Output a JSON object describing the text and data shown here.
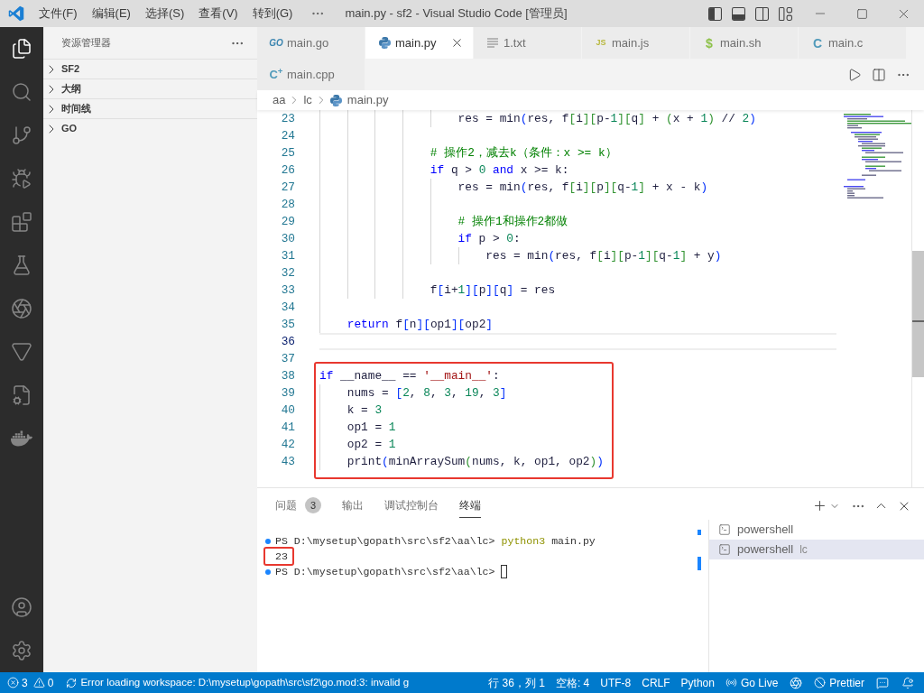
{
  "title_bar": {
    "menus": [
      "文件(F)",
      "编辑(E)",
      "选择(S)",
      "查看(V)",
      "转到(G)"
    ],
    "title": "main.py - sf2 - Visual Studio Code [管理员]",
    "layout_toggles": [
      {
        "kind": "sidebar",
        "on": true
      },
      {
        "kind": "panel",
        "on": true
      },
      {
        "kind": "secondary",
        "on": false
      }
    ]
  },
  "activity_bar": {
    "items": [
      {
        "kind": "explorer",
        "selected": true
      },
      {
        "kind": "search",
        "selected": false
      },
      {
        "kind": "scm",
        "selected": false
      },
      {
        "kind": "debug",
        "selected": false
      },
      {
        "kind": "extensions",
        "selected": false
      },
      {
        "kind": "testing",
        "selected": false
      },
      {
        "kind": "ai",
        "selected": false
      },
      {
        "kind": "triangle",
        "selected": false
      },
      {
        "kind": "remote",
        "selected": false
      },
      {
        "kind": "docker",
        "selected": false
      }
    ]
  },
  "sidebar": {
    "title": "资源管理器",
    "sections": [
      {
        "label": "SF2",
        "expanded": false
      },
      {
        "label": "大纲",
        "expanded": false
      },
      {
        "label": "时间线",
        "expanded": false
      },
      {
        "label": "GO",
        "expanded": false
      }
    ]
  },
  "tabs": [
    {
      "label": "main.go",
      "kind": "go",
      "icon_text": "GO",
      "selected": false
    },
    {
      "label": "main.py",
      "kind": "python",
      "selected": true
    },
    {
      "label": "1.txt",
      "kind": "text",
      "selected": false
    },
    {
      "label": "main.js",
      "kind": "js",
      "icon_text": "JS",
      "selected": false
    },
    {
      "label": "main.sh",
      "kind": "shell",
      "icon_text": "$",
      "selected": false
    },
    {
      "label": "main.c",
      "kind": "c",
      "icon_text": "C",
      "selected": false
    },
    {
      "label": "main.cpp",
      "kind": "cpp",
      "icon_text": "C$^{+}$",
      "selected": false
    }
  ],
  "breadcrumb": [
    {
      "label": "aa",
      "kind": "folder"
    },
    {
      "label": "lc",
      "kind": "folder"
    },
    {
      "label": "main.py",
      "kind": "python"
    }
  ],
  "editor": {
    "blocks": [
      {
        "highlighted": false,
        "lines": [
          {
            "children": [
              {
                "children": [
                  {
                    "children": [
                      {
                        "children": [
                          {
                            "children": [
                              {
                                "number": "23",
                                "current": false,
                                "code": [
                                  {
                                    "kind": "plain",
                                    "text": "res = min"
                                  },
                                  {
                                    "kind": "b1",
                                    "text": "("
                                  },
                                  {
                                    "kind": "plain",
                                    "text": "res, f"
                                  },
                                  {
                                    "kind": "b2",
                                    "text": "["
                                  },
                                  {
                                    "kind": "plain",
                                    "text": "i"
                                  },
                                  {
                                    "kind": "b2",
                                    "text": "]["
                                  },
                                  {
                                    "kind": "plain",
                                    "text": "p-"
                                  },
                                  {
                                    "kind": "num",
                                    "text": "1"
                                  },
                                  {
                                    "kind": "b2",
                                    "text": "]["
                                  },
                                  {
                                    "kind": "plain",
                                    "text": "q"
                                  },
                                  {
                                    "kind": "b2",
                                    "text": "]"
                                  },
                                  {
                                    "kind": "plain",
                                    "text": " + "
                                  },
                                  {
                                    "kind": "b2",
                                    "text": "("
                                  },
                                  {
                                    "kind": "plain",
                                    "text": "x + "
                                  },
                                  {
                                    "kind": "num",
                                    "text": "1"
                                  },
                                  {
                                    "kind": "b2",
                                    "text": ")"
                                  },
                                  {
                                    "kind": "plain",
                                    "text": " // "
                                  },
                                  {
                                    "kind": "num",
                                    "text": "2"
                                  },
                                  {
                                    "kind": "b1",
                                    "text": ")"
                                  }
                                ]
                              }
                            ]
                          },
                          {
                            "number": "24",
                            "current": false
                          },
                          {
                            "number": "25",
                            "current": false,
                            "code": [
                              {
                                "kind": "comment",
                                "text": "# 操作2，减去k（条件：x >= k）"
                              }
                            ]
                          },
                          {
                            "number": "26",
                            "current": false,
                            "code": [
                              {
                                "kind": "kw",
                                "text": "if"
                              },
                              {
                                "kind": "plain",
                                "text": " q > "
                              },
                              {
                                "kind": "num",
                                "text": "0"
                              },
                              {
                                "kind": "kw",
                                "text": " and"
                              },
                              {
                                "kind": "plain",
                                "text": " x >= k:"
                              }
                            ],
                            "children": [
                              {
                                "number": "27",
                                "current": false,
                                "code": [
                                  {
                                    "kind": "plain",
                                    "text": "res = min"
                                  },
                                  {
                                    "kind": "b1",
                                    "text": "("
                                  },
                                  {
                                    "kind": "plain",
                                    "text": "res, f"
                                  },
                                  {
                                    "kind": "b2",
                                    "text": "["
                                  },
                                  {
                                    "kind": "plain",
                                    "text": "i"
                                  },
                                  {
                                    "kind": "b2",
                                    "text": "]["
                                  },
                                  {
                                    "kind": "plain",
                                    "text": "p"
                                  },
                                  {
                                    "kind": "b2",
                                    "text": "]["
                                  },
                                  {
                                    "kind": "plain",
                                    "text": "q-"
                                  },
                                  {
                                    "kind": "num",
                                    "text": "1"
                                  },
                                  {
                                    "kind": "b2",
                                    "text": "]"
                                  },
                                  {
                                    "kind": "plain",
                                    "text": " + x - k"
                                  },
                                  {
                                    "kind": "b1",
                                    "text": ")"
                                  }
                                ]
                              },
                              {
                                "number": "28",
                                "current": false
                              },
                              {
                                "number": "29",
                                "current": false,
                                "code": [
                                  {
                                    "kind": "comment",
                                    "text": "# 操作1和操作2都做"
                                  }
                                ]
                              },
                              {
                                "number": "30",
                                "current": false,
                                "code": [
                                  {
                                    "kind": "kw",
                                    "text": "if"
                                  },
                                  {
                                    "kind": "plain",
                                    "text": " p > "
                                  },
                                  {
                                    "kind": "num",
                                    "text": "0"
                                  },
                                  {
                                    "kind": "plain",
                                    "text": ":"
                                  }
                                ],
                                "children": [
                                  {
                                    "number": "31",
                                    "current": false,
                                    "code": [
                                      {
                                        "kind": "plain",
                                        "text": "res = min"
                                      },
                                      {
                                        "kind": "b1",
                                        "text": "("
                                      },
                                      {
                                        "kind": "plain",
                                        "text": "res, f"
                                      },
                                      {
                                        "kind": "b2",
                                        "text": "["
                                      },
                                      {
                                        "kind": "plain",
                                        "text": "i"
                                      },
                                      {
                                        "kind": "b2",
                                        "text": "]["
                                      },
                                      {
                                        "kind": "plain",
                                        "text": "p-"
                                      },
                                      {
                                        "kind": "num",
                                        "text": "1"
                                      },
                                      {
                                        "kind": "b2",
                                        "text": "]["
                                      },
                                      {
                                        "kind": "plain",
                                        "text": "q-"
                                      },
                                      {
                                        "kind": "num",
                                        "text": "1"
                                      },
                                      {
                                        "kind": "b2",
                                        "text": "]"
                                      },
                                      {
                                        "kind": "plain",
                                        "text": " + y"
                                      },
                                      {
                                        "kind": "b1",
                                        "text": ")"
                                      }
                                    ]
                                  }
                                ]
                              }
                            ]
                          },
                          {
                            "number": "32",
                            "current": false
                          },
                          {
                            "number": "33",
                            "current": false,
                            "code": [
                              {
                                "kind": "plain",
                                "text": "f"
                              },
                              {
                                "kind": "b1",
                                "text": "["
                              },
                              {
                                "kind": "plain",
                                "text": "i+"
                              },
                              {
                                "kind": "num",
                                "text": "1"
                              },
                              {
                                "kind": "b1",
                                "text": "]["
                              },
                              {
                                "kind": "plain",
                                "text": "p"
                              },
                              {
                                "kind": "b1",
                                "text": "]["
                              },
                              {
                                "kind": "plain",
                                "text": "q"
                              },
                              {
                                "kind": "b1",
                                "text": "]"
                              },
                              {
                                "kind": "plain",
                                "text": " = res"
                              }
                            ]
                          }
                        ]
                      }
                    ]
                  }
                ]
              },
              {
                "number": "34",
                "current": false
              },
              {
                "number": "35",
                "current": false,
                "code": [
                  {
                    "kind": "kw",
                    "text": "return"
                  },
                  {
                    "kind": "plain",
                    "text": " f"
                  },
                  {
                    "kind": "b1",
                    "text": "["
                  },
                  {
                    "kind": "plain",
                    "text": "n"
                  },
                  {
                    "kind": "b1",
                    "text": "]["
                  },
                  {
                    "kind": "plain",
                    "text": "op1"
                  },
                  {
                    "kind": "b1",
                    "text": "]["
                  },
                  {
                    "kind": "plain",
                    "text": "op2"
                  },
                  {
                    "kind": "b1",
                    "text": "]"
                  }
                ]
              }
            ]
          },
          {
            "number": "36",
            "current": true
          },
          {
            "number": "37",
            "current": false
          }
        ]
      },
      {
        "highlighted": true,
        "lines": [
          {
            "number": "38",
            "current": false,
            "code": [
              {
                "kind": "kw",
                "text": "if"
              },
              {
                "kind": "plain",
                "text": " __name__ == "
              },
              {
                "kind": "str",
                "text": "'__main__'"
              },
              {
                "kind": "plain",
                "text": ":"
              }
            ],
            "children": [
              {
                "number": "39",
                "current": false,
                "code": [
                  {
                    "kind": "plain",
                    "text": "nums = "
                  },
                  {
                    "kind": "b1",
                    "text": "["
                  },
                  {
                    "kind": "num",
                    "text": "2"
                  },
                  {
                    "kind": "plain",
                    "text": ", "
                  },
                  {
                    "kind": "num",
                    "text": "8"
                  },
                  {
                    "kind": "plain",
                    "text": ", "
                  },
                  {
                    "kind": "num",
                    "text": "3"
                  },
                  {
                    "kind": "plain",
                    "text": ", "
                  },
                  {
                    "kind": "num",
                    "text": "19"
                  },
                  {
                    "kind": "plain",
                    "text": ", "
                  },
                  {
                    "kind": "num",
                    "text": "3"
                  },
                  {
                    "kind": "b1",
                    "text": "]"
                  }
                ]
              },
              {
                "number": "40",
                "current": false,
                "code": [
                  {
                    "kind": "plain",
                    "text": "k = "
                  },
                  {
                    "kind": "num",
                    "text": "3"
                  }
                ]
              },
              {
                "number": "41",
                "current": false,
                "code": [
                  {
                    "kind": "plain",
                    "text": "op1 = "
                  },
                  {
                    "kind": "num",
                    "text": "1"
                  }
                ]
              },
              {
                "number": "42",
                "current": false,
                "code": [
                  {
                    "kind": "plain",
                    "text": "op2 = "
                  },
                  {
                    "kind": "num",
                    "text": "1"
                  }
                ]
              },
              {
                "number": "43",
                "current": false,
                "code": [
                  {
                    "kind": "plain",
                    "text": "print"
                  },
                  {
                    "kind": "b1",
                    "text": "("
                  },
                  {
                    "kind": "plain",
                    "text": "minArraySum"
                  },
                  {
                    "kind": "b2",
                    "text": "("
                  },
                  {
                    "kind": "plain",
                    "text": "nums, k, op1, op2"
                  },
                  {
                    "kind": "b2",
                    "text": ")"
                  },
                  {
                    "kind": "b1",
                    "text": ")"
                  }
                ]
              }
            ]
          }
        ]
      }
    ]
  },
  "panel": {
    "tabs": [
      {
        "label": "问题",
        "badge": "3",
        "selected": false
      },
      {
        "label": "输出",
        "selected": false
      },
      {
        "label": "调试控制台",
        "selected": false
      },
      {
        "label": "终端",
        "selected": true
      }
    ],
    "terminal": {
      "lines": [
        {
          "kind": "prompt",
          "prompt": "PS D:\\mysetup\\gopath\\src\\sf2\\aa\\lc>",
          "command": "python3",
          "args": "main.py",
          "cursor": false,
          "highlighted": false
        },
        {
          "kind": "output",
          "text": "23",
          "highlighted": true
        },
        {
          "kind": "prompt",
          "prompt": "PS D:\\mysetup\\gopath\\src\\sf2\\aa\\lc>",
          "cursor": true,
          "highlighted": false
        }
      ]
    },
    "terminals": [
      {
        "label": "powershell",
        "selected": false
      },
      {
        "label": "powershell",
        "description": "lc",
        "selected": true
      }
    ]
  },
  "status_bar": {
    "problems": {
      "errors": "3",
      "warnings": "0"
    },
    "message": "Error loading workspace: D:\\mysetup\\gopath\\src\\sf2\\go.mod:3: invalid g",
    "items": [
      {
        "kind": "text",
        "text": "行 36，列 1"
      },
      {
        "kind": "text",
        "text": "空格: 4"
      },
      {
        "kind": "text",
        "text": "UTF-8"
      },
      {
        "kind": "text",
        "text": "CRLF"
      },
      {
        "kind": "text",
        "text": "Python"
      },
      {
        "kind": "broadcast",
        "text": "Go Live"
      },
      {
        "kind": "spark"
      },
      {
        "kind": "prettier",
        "text": "Prettier"
      },
      {
        "kind": "feedback"
      },
      {
        "kind": "bell"
      }
    ]
  }
}
